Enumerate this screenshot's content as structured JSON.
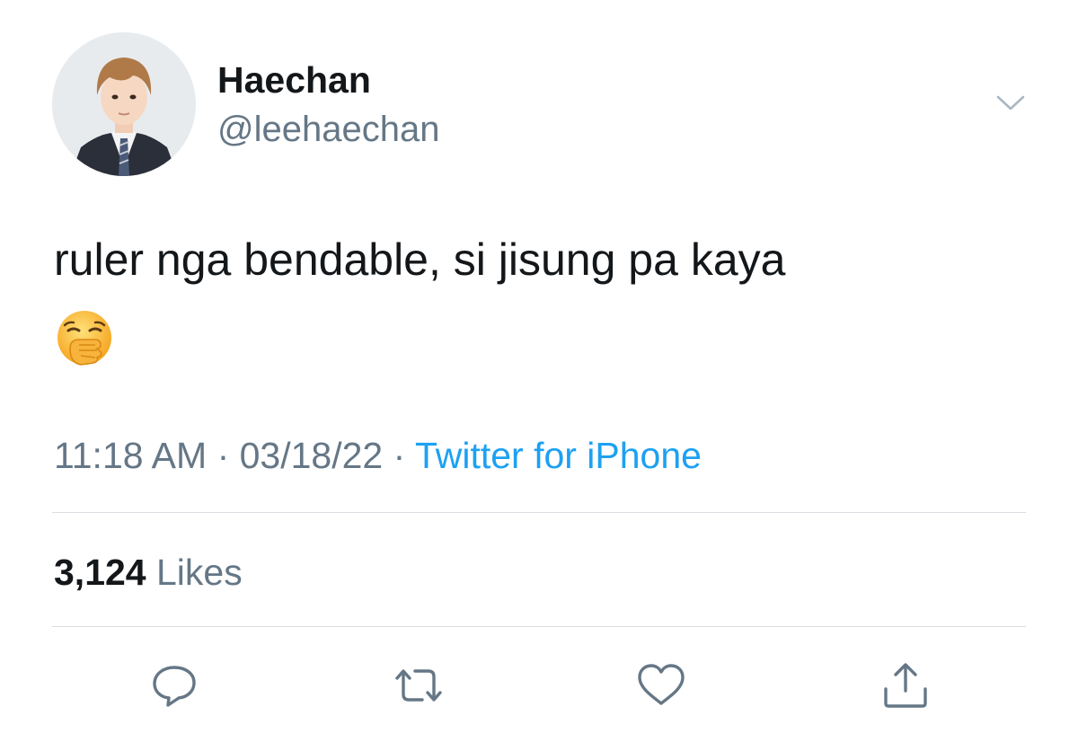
{
  "user": {
    "display_name": "Haechan",
    "handle": "@leehaechan"
  },
  "tweet": {
    "text": "ruler nga bendable, si jisung pa kaya",
    "emoji": "face-with-hand-over-mouth"
  },
  "meta": {
    "time": "11:18 AM",
    "separator_1": " · ",
    "date": "03/18/22",
    "separator_2": " · ",
    "source": "Twitter for iPhone"
  },
  "engagement": {
    "likes_count": "3,124",
    "likes_label": " Likes"
  },
  "actions": [
    {
      "icon": "reply-icon"
    },
    {
      "icon": "retweet-icon"
    },
    {
      "icon": "like-icon"
    },
    {
      "icon": "share-icon"
    }
  ],
  "colors": {
    "text_primary": "#14171a",
    "text_secondary": "#657786",
    "link": "#1da1f2",
    "divider": "#d9dde1"
  }
}
